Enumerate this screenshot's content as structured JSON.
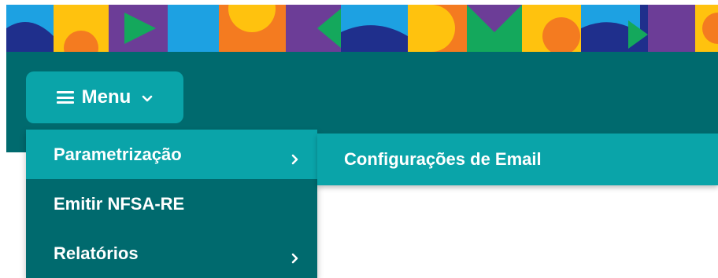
{
  "colors": {
    "header_bar": "#006a6e",
    "accent": "#0aa4a9",
    "text": "#ffffff",
    "banner_navy": "#1f2f8c",
    "banner_yellow": "#ffc20e",
    "banner_orange": "#f47b20",
    "banner_purple": "#6c3d97",
    "banner_green": "#14a85c",
    "banner_blue": "#1da1e2"
  },
  "menu_button": {
    "label": "Menu",
    "icon": "hamburger-icon",
    "caret_icon": "chevron-down-icon"
  },
  "dropdown": {
    "items": [
      {
        "label": "Parametrização",
        "has_submenu": true,
        "active": true
      },
      {
        "label": "Emitir NFSA-RE",
        "has_submenu": false,
        "active": false
      },
      {
        "label": "Relatórios",
        "has_submenu": true,
        "active": false
      }
    ],
    "arrow_icon": "chevron-right-icon"
  },
  "submenu": {
    "items": [
      {
        "label": "Configurações de Email"
      }
    ]
  }
}
